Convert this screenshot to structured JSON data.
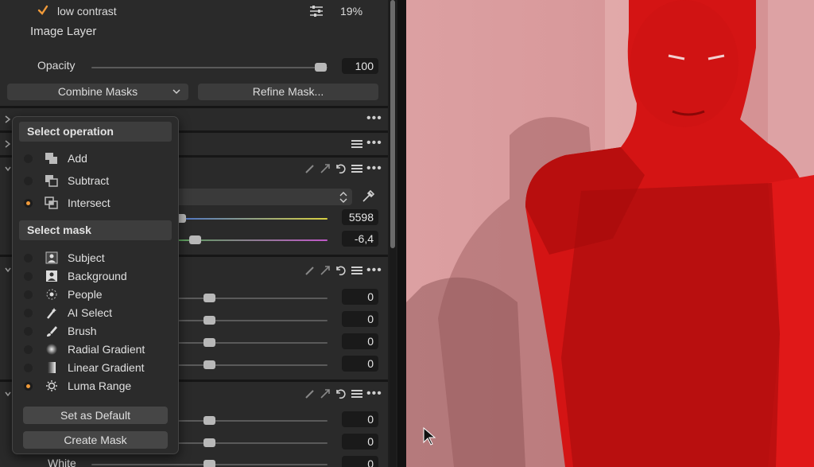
{
  "layer_row": {
    "checkbox_checked": true,
    "name": "low contrast",
    "opacity_value": "19%"
  },
  "image_layer_title": "Image Layer",
  "opacity": {
    "label": "Opacity",
    "value": "100",
    "slider_level": 0.98
  },
  "buttons": {
    "combine_masks": "Combine Masks",
    "refine_mask": "Refine Mask..."
  },
  "wb": {
    "kelvin_value": "5598",
    "tint_value": "-6,4"
  },
  "sliders_group1": [
    "0",
    "0",
    "0",
    "0"
  ],
  "sliders_group2": [
    "0",
    "0",
    "0"
  ],
  "partial_label_white": "White",
  "popup": {
    "operation_header": "Select operation",
    "operations": [
      {
        "label": "Add",
        "icon": "add-icon",
        "selected": false
      },
      {
        "label": "Subtract",
        "icon": "subtract-icon",
        "selected": false
      },
      {
        "label": "Intersect",
        "icon": "intersect-icon",
        "selected": true
      }
    ],
    "mask_header": "Select mask",
    "masks": [
      {
        "label": "Subject",
        "icon": "subject-icon",
        "selected": false
      },
      {
        "label": "Background",
        "icon": "background-icon",
        "selected": false
      },
      {
        "label": "People",
        "icon": "people-icon",
        "selected": false
      },
      {
        "label": "AI Select",
        "icon": "ai-select-icon",
        "selected": false
      },
      {
        "label": "Brush",
        "icon": "brush-icon",
        "selected": false
      },
      {
        "label": "Radial Gradient",
        "icon": "radial-gradient-icon",
        "selected": false
      },
      {
        "label": "Linear Gradient",
        "icon": "linear-gradient-icon",
        "selected": false
      },
      {
        "label": "Luma Range",
        "icon": "luma-range-icon",
        "selected": true
      }
    ],
    "set_default": "Set as Default",
    "create_mask": "Create Mask"
  },
  "colors": {
    "accent": "#f09a3a",
    "mask_overlay": "#d41414",
    "background_pink": "#d89a9c"
  }
}
